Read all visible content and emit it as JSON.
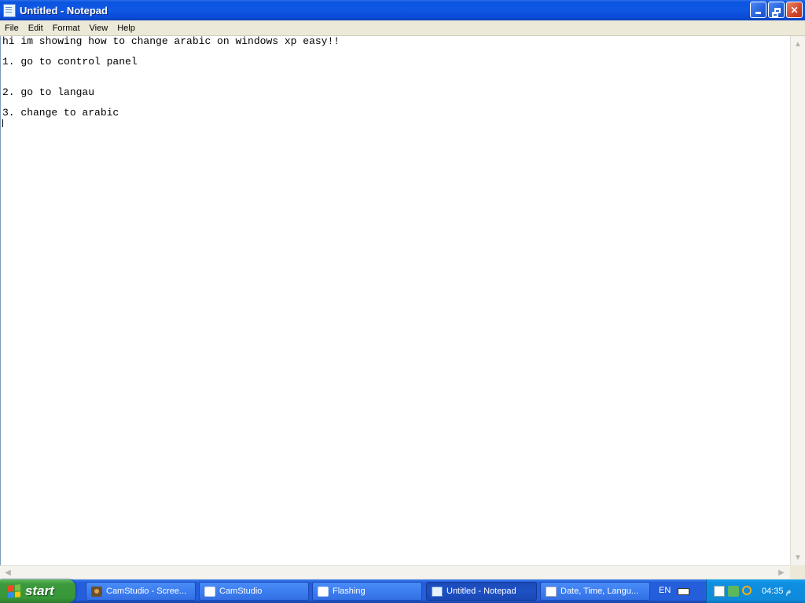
{
  "window": {
    "title": "Untitled - Notepad"
  },
  "menu": [
    "File",
    "Edit",
    "Format",
    "View",
    "Help"
  ],
  "document": {
    "lines": [
      "hi im showing how to change arabic on windows xp easy!!",
      "",
      "1. go to control panel",
      "",
      "",
      "2. go to langau",
      "",
      "3. change to arabic"
    ]
  },
  "taskbar": {
    "start_label": "start",
    "buttons": [
      {
        "label": "CamStudio - Scree...",
        "icon": "camstudio-icon"
      },
      {
        "label": "CamStudio",
        "icon": "folder-icon"
      },
      {
        "label": "Flashing",
        "icon": "folder-icon"
      },
      {
        "label": "Untitled - Notepad",
        "icon": "notepad-icon",
        "active": true
      },
      {
        "label": "Date, Time, Langu...",
        "icon": "document-icon"
      }
    ],
    "language": "EN",
    "clock": "04:35 م"
  }
}
